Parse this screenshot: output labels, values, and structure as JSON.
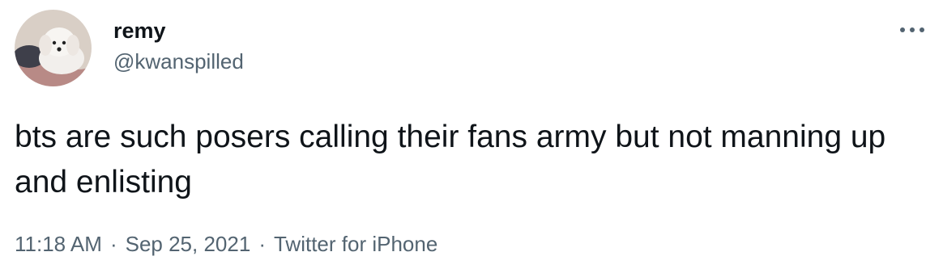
{
  "user": {
    "display_name": "remy",
    "handle": "@kwanspilled",
    "avatar_icon": "dog-avatar"
  },
  "tweet": {
    "text": "bts are such posers calling their fans army but not manning up and enlisting"
  },
  "meta": {
    "time": "11:18 AM",
    "date": "Sep 25, 2021",
    "separator": "·",
    "source": "Twitter for iPhone"
  },
  "icons": {
    "more": "more-options-icon"
  },
  "colors": {
    "text_primary": "#0f1419",
    "text_secondary": "#536471"
  }
}
